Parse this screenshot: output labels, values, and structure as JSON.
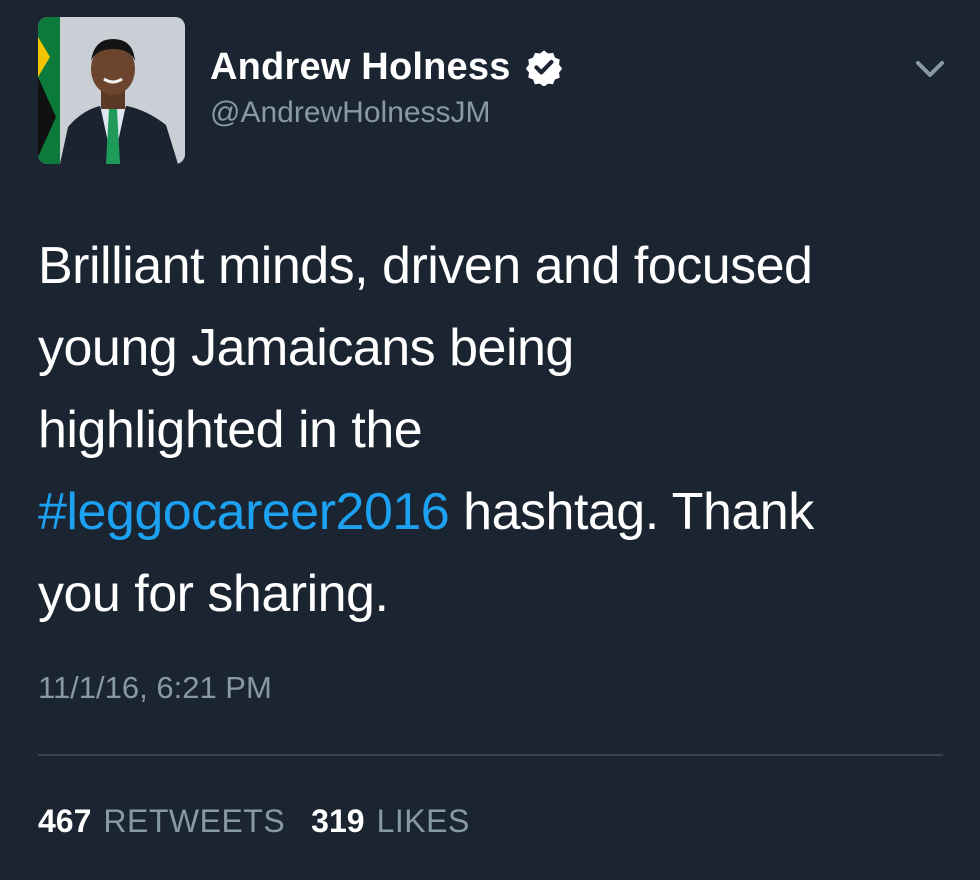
{
  "user": {
    "display_name": "Andrew Holness",
    "handle": "@AndrewHolnessJM",
    "verified": true
  },
  "tweet": {
    "lines": [
      "Brilliant minds, driven and focused",
      "young Jamaicans being",
      "highlighted in the"
    ],
    "hashtag": "#leggocareer2016",
    "after_hashtag": " hashtag. Thank",
    "last_line": "you for sharing.",
    "timestamp": "11/1/16, 6:21 PM"
  },
  "stats": {
    "retweets_count": "467",
    "retweets_label": "RETWEETS",
    "likes_count": "319",
    "likes_label": "LIKES"
  },
  "icons": {
    "verified": "verified-badge-icon",
    "menu": "chevron-down-icon"
  },
  "colors": {
    "background": "#1b2532",
    "text": "#ffffff",
    "muted": "#8899a6",
    "link": "#1da1f2",
    "divider": "#38444d"
  }
}
